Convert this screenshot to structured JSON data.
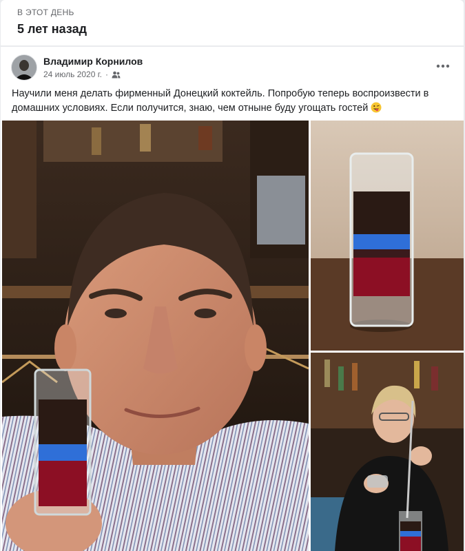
{
  "memory": {
    "kicker": "В ЭТОТ ДЕНЬ",
    "title": "5 лет назад"
  },
  "post": {
    "author": "Владимир Корнилов",
    "date": "24 июль 2020 г.",
    "separator": "·",
    "audience_icon": "friends-icon",
    "more_icon": "more-options-icon",
    "text": "Научили меня делать фирменный Донецкий коктейль. Попробую теперь воспроизвести в домашних условиях. Если получится, знаю, чем отныне буду угощать гостей",
    "emoji": "winking-tongue-emoji"
  },
  "photos": [
    {
      "id": "photo-main",
      "subject": "man holding layered shot"
    },
    {
      "id": "photo-glass",
      "subject": "layered cocktail glass"
    },
    {
      "id": "photo-bartender",
      "subject": "bartender pouring layers"
    }
  ],
  "colors": {
    "background": "#e9ebee",
    "card": "#ffffff",
    "text_primary": "#1c1e21",
    "text_secondary": "#65676b",
    "layer_dark": "#2a1a14",
    "layer_blue": "#2f6fd8",
    "layer_red": "#8c0f24"
  }
}
